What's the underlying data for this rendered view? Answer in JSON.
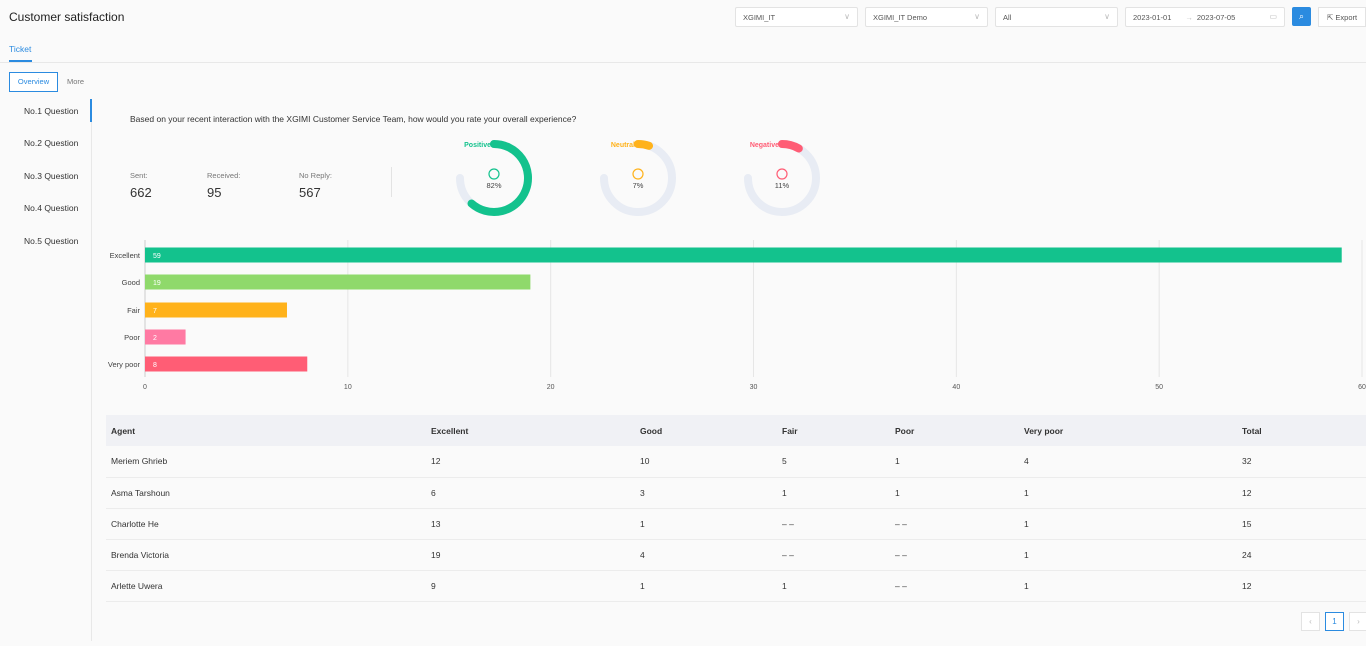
{
  "header": {
    "title": "Customer satisfaction",
    "filters": [
      "XGIMI_IT",
      "XGIMI_IT Demo",
      "All"
    ],
    "date_start": "2023-01-01",
    "date_end": "2023-07-05",
    "export_label": "Export"
  },
  "tabs": [
    "Ticket"
  ],
  "subtabs": [
    "Overview",
    "More"
  ],
  "questions": [
    "No.1 Question",
    "No.2 Question",
    "No.3 Question",
    "No.4 Question",
    "No.5 Question"
  ],
  "question_text": "Based on your recent interaction with the XGIMI Customer Service Team, how would you rate your overall experience?",
  "stats": [
    {
      "label": "Sent:",
      "value": "662"
    },
    {
      "label": "Received:",
      "value": "95"
    },
    {
      "label": "No Reply:",
      "value": "567"
    }
  ],
  "gauges": [
    {
      "label": "Positive",
      "percent": 82,
      "text": "82%",
      "color": "#13c28d",
      "icon": "smile-icon"
    },
    {
      "label": "Neutral",
      "percent": 7,
      "text": "7%",
      "color": "#ffb21a",
      "icon": "neutral-face-icon"
    },
    {
      "label": "Negative",
      "percent": 11,
      "text": "11%",
      "color": "#ff5d75",
      "icon": "sad-face-icon"
    }
  ],
  "chart_data": {
    "type": "bar",
    "orientation": "horizontal",
    "categories": [
      "Excellent",
      "Good",
      "Fair",
      "Poor",
      "Very poor"
    ],
    "values": [
      59,
      19,
      7,
      2,
      8
    ],
    "colors": [
      "#13c28d",
      "#8fd96b",
      "#ffb21a",
      "#ff7aa3",
      "#ff5d75"
    ],
    "xlim": [
      0,
      60
    ],
    "xticks": [
      0,
      10,
      20,
      30,
      40,
      50,
      60
    ],
    "grid": true
  },
  "table": {
    "headers": [
      "Agent",
      "Excellent",
      "Good",
      "Fair",
      "Poor",
      "Very poor",
      "Total"
    ],
    "rows": [
      [
        "Meriem Ghrieb",
        "12",
        "10",
        "5",
        "1",
        "4",
        "32"
      ],
      [
        "Asma Tarshoun",
        "6",
        "3",
        "1",
        "1",
        "1",
        "12"
      ],
      [
        "Charlotte He",
        "13",
        "1",
        "– –",
        "– –",
        "1",
        "15"
      ],
      [
        "Brenda Victoria",
        "19",
        "4",
        "– –",
        "– –",
        "1",
        "24"
      ],
      [
        "Arlette Uwera",
        "9",
        "1",
        "1",
        "– –",
        "1",
        "12"
      ]
    ]
  },
  "pagination": {
    "current": "1"
  }
}
